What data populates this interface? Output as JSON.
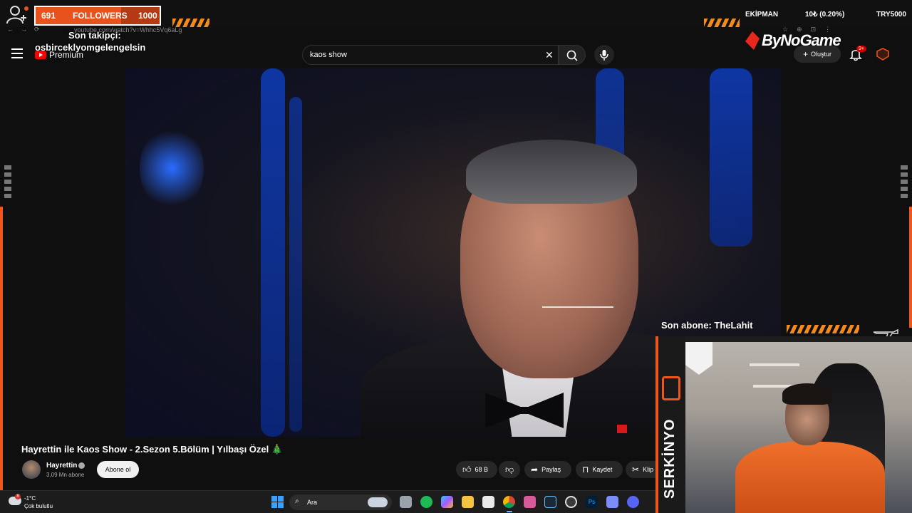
{
  "overlay": {
    "followers_count": "691",
    "followers_label": "FOLLOWERS",
    "followers_goal": "1000",
    "followers_progress": 0.691,
    "son_takipci_label": "Son takipçi:",
    "son_takipci_name": "osbirceklyomgelengelsin",
    "ekipman": "EKİPMAN",
    "ticker_mid": "10₺ (0.20%)",
    "ticker_right": "TRY5000",
    "sponsor": "ByNoGame",
    "son_abone": "Son abone: TheLahit",
    "streamer_name": "SERKİNYO",
    "accent_color": "#f0551c"
  },
  "browser": {
    "url": "youtube.com/watch?v=Whhc5Vq6aLg"
  },
  "youtube": {
    "premium_label": "Premium",
    "search_value": "kaos show",
    "create_label": "Oluştur",
    "notification_badge": "9+",
    "video_title": "Hayrettin ile Kaos Show - 2.Sezon 5.Bölüm | Yılbaşı Özel 🎄",
    "channel_name": "Hayrettin",
    "subscribers": "3,09 Mn abone",
    "subscribe_label": "Abone ol",
    "like_count": "68 B",
    "share_label": "Paylaş",
    "save_label": "Kaydet",
    "clip_label": "Klip"
  },
  "taskbar": {
    "weather_badge": "8",
    "temperature": "-1°C",
    "condition": "Çok bulutlu",
    "search_placeholder": "Ara"
  },
  "icons": {
    "menu": "hamburger-icon",
    "search": "search-icon",
    "mic": "mic-icon",
    "bell": "bell-icon",
    "like": "thumbs-up-icon",
    "dislike": "thumbs-down-icon",
    "share": "share-icon",
    "save": "bookmark-icon",
    "clip": "scissors-icon"
  }
}
